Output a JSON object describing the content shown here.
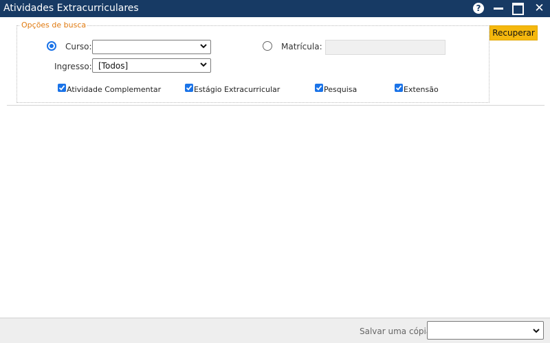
{
  "window": {
    "title": "Atividades Extracurriculares",
    "help_symbol": "?",
    "close_symbol": "✕",
    "icons": [
      "help-icon",
      "minimize-icon",
      "maximize-icon",
      "close-icon"
    ]
  },
  "search": {
    "legend": "Opções de busca",
    "recuperar_label": "Recuperar",
    "curso": {
      "label": "Curso:",
      "selected": true,
      "value": ""
    },
    "matricula": {
      "label": "Matrícula:",
      "selected": false,
      "value": ""
    },
    "ingresso": {
      "label": "Ingresso:",
      "value": "[Todos]"
    },
    "checkboxes": [
      {
        "label": "Atividade Complementar",
        "checked": true
      },
      {
        "label": "Estágio Extracurricular",
        "checked": true
      },
      {
        "label": "Pesquisa",
        "checked": true
      },
      {
        "label": "Extensão",
        "checked": true
      }
    ]
  },
  "footer": {
    "salvar_label": "Salvar uma cópia:",
    "salvar_value": ""
  },
  "colors": {
    "titlebar": "#173a64",
    "accent": "#1a73e8",
    "button": "#f5b80e",
    "legend": "#e07a10"
  }
}
